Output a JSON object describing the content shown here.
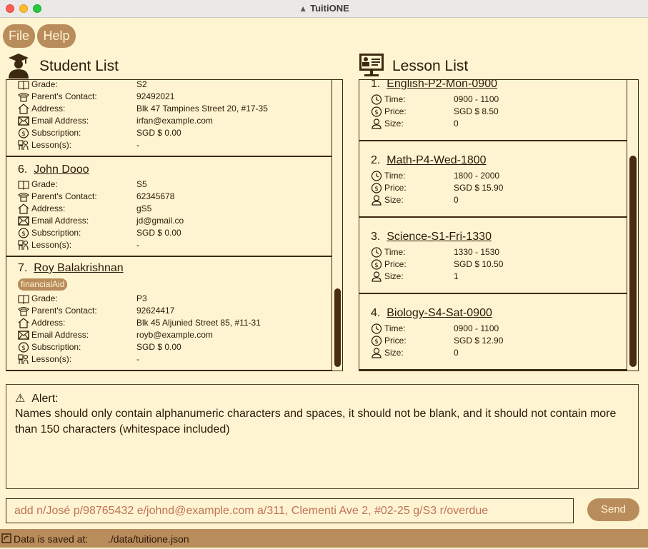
{
  "window": {
    "title": "TuitiONE"
  },
  "menu": {
    "file": "File",
    "help": "Help"
  },
  "student_panel": {
    "title": "Student List",
    "labels": {
      "grade": "Grade:",
      "contact": "Parent's Contact:",
      "address": "Address:",
      "email": "Email Address:",
      "subscription": "Subscription:",
      "lessons": "Lesson(s):"
    },
    "students": [
      {
        "index": "",
        "name": "",
        "tag": "",
        "grade": "S2",
        "contact": "92492021",
        "address": "Blk 47 Tampines Street 20, #17-35",
        "email": "irfan@example.com",
        "subscription": "SGD $ 0.00",
        "lessons": "-"
      },
      {
        "index": "6.",
        "name": "John Dooo",
        "tag": "",
        "grade": "S5",
        "contact": "62345678",
        "address": "gS5",
        "email": "jd@gmail.co",
        "subscription": "SGD $ 0.00",
        "lessons": "-"
      },
      {
        "index": "7.",
        "name": "Roy Balakrishnan",
        "tag": "financialAid",
        "grade": "P3",
        "contact": "92624417",
        "address": "Blk 45 Aljunied Street 85, #11-31",
        "email": "royb@example.com",
        "subscription": "SGD $ 0.00",
        "lessons": "-"
      }
    ],
    "scroll_fraction": 0.92
  },
  "lesson_panel": {
    "title": "Lesson List",
    "labels": {
      "time": "Time:",
      "price": "Price:",
      "size": "Size:"
    },
    "lessons": [
      {
        "index": "1.",
        "code": "English-P2-Mon-0900",
        "time": "0900 - 1100",
        "price": "SGD $ 8.50",
        "size": "0"
      },
      {
        "index": "2.",
        "code": "Math-P4-Wed-1800",
        "time": "1800 - 2000",
        "price": "SGD $ 15.90",
        "size": "0"
      },
      {
        "index": "3.",
        "code": "Science-S1-Fri-1330",
        "time": "1330 - 1530",
        "price": "SGD $ 10.50",
        "size": "1"
      },
      {
        "index": "4.",
        "code": "Biology-S4-Sat-0900",
        "time": "0900 - 1100",
        "price": "SGD $ 12.90",
        "size": "0"
      }
    ]
  },
  "alert": {
    "label": "Alert:",
    "message": "Names should only contain alphanumeric characters and spaces, it should not be blank, and it should not contain more than 150 characters (whitespace included)"
  },
  "command": {
    "value": "add n/José p/98765432 e/johnd@example.com a/311, Clementi Ave 2, #02-25 g/S3 r/overdue",
    "send_label": "Send"
  },
  "status": {
    "label": "Data is saved at:",
    "path": "./data/tuitione.json"
  },
  "colors": {
    "background": "#fff4d1",
    "accent": "#b98c5c",
    "text": "#2b1a08",
    "error_text": "#c0725a"
  }
}
